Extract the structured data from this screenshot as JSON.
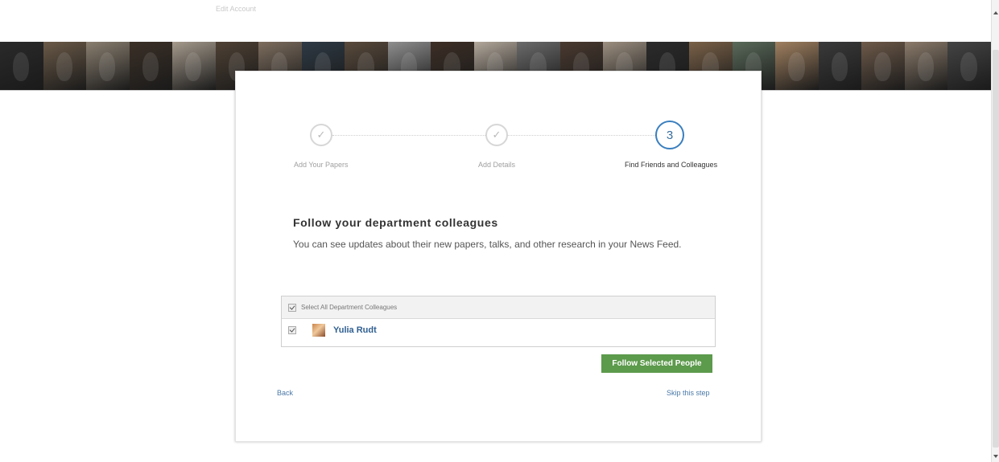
{
  "header": {
    "faint_text": "Edit Account"
  },
  "photo_strip": {
    "tile_colors": [
      "#2a2a2a",
      "#6b5a48",
      "#8a7f70",
      "#3b3027",
      "#a59a8c",
      "#4f4134",
      "#7d6d5e",
      "#2e3a45",
      "#594a3c",
      "#8f8f8f",
      "#3d2f26",
      "#b3a89b",
      "#6b6b6b",
      "#4a3a30",
      "#9c8f80",
      "#2b2b2b",
      "#7a6148",
      "#5a6a5a",
      "#a08060",
      "#3a3a3a",
      "#6e5a4a",
      "#8b7b6b",
      "#444444"
    ]
  },
  "steps": [
    {
      "label": "Add Your Papers",
      "state": "done",
      "icon": "checkmark-icon",
      "symbol": "✓"
    },
    {
      "label": "Add Details",
      "state": "done",
      "icon": "checkmark-icon",
      "symbol": "✓"
    },
    {
      "label": "Find Friends and Colleagues",
      "state": "current",
      "number": "3"
    }
  ],
  "main": {
    "heading": "Follow your department colleagues",
    "subtext": "You can see updates about their new papers, talks, and other research in your News Feed."
  },
  "colleagues": {
    "select_all_label": "Select All Department Colleagues",
    "select_all_checked": true,
    "people": [
      {
        "name": "Yulia Rudt",
        "checked": true
      }
    ]
  },
  "actions": {
    "follow_button": "Follow Selected People",
    "back_link": "Back",
    "skip_link": "Skip this step"
  },
  "colors": {
    "accent_blue": "#3a7fbf",
    "button_green": "#5c9a4c",
    "link_blue": "#4a79a8"
  }
}
